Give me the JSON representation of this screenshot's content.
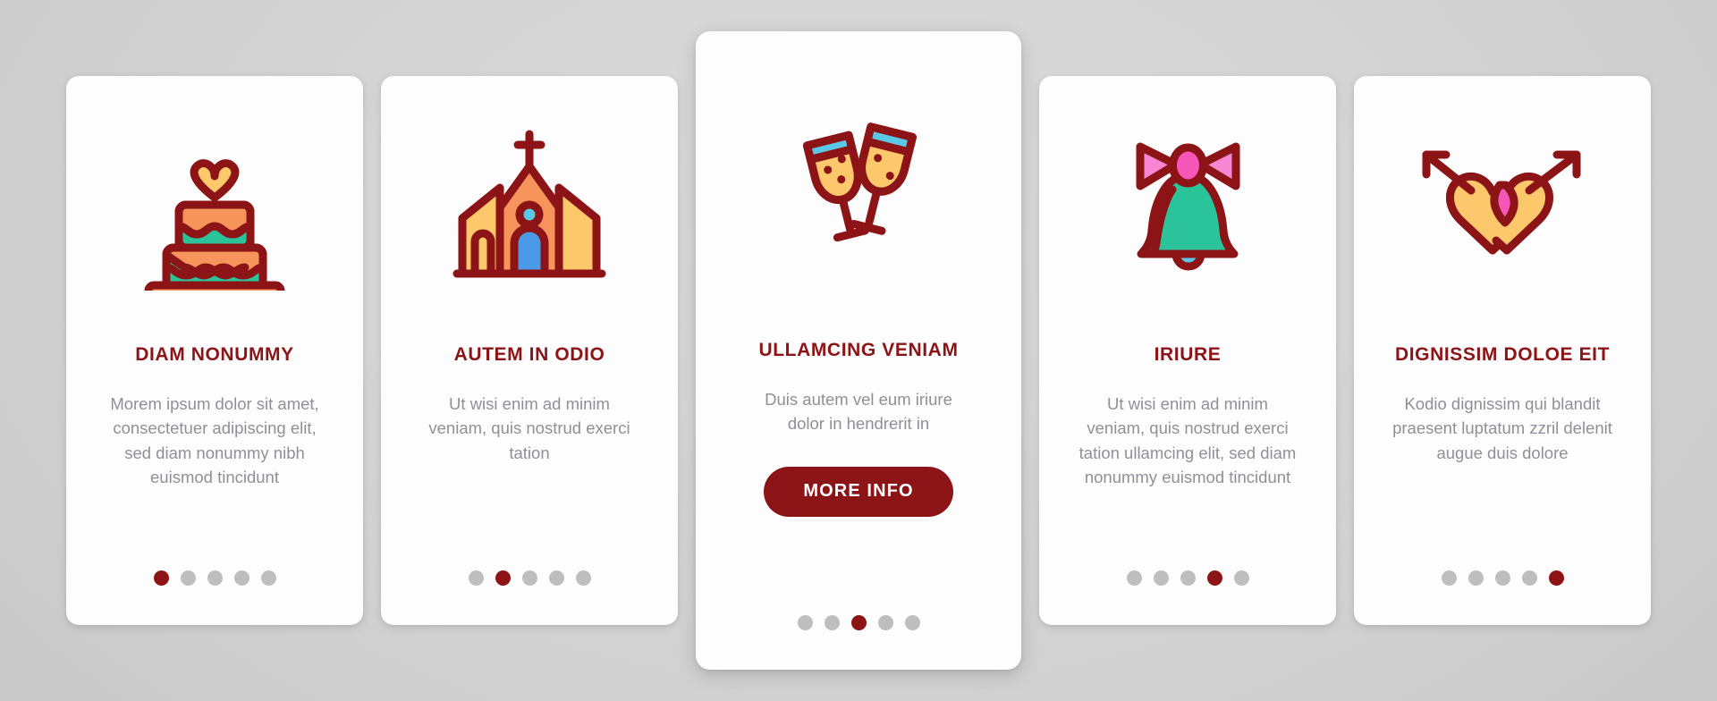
{
  "theme": {
    "accent_dark_red": "#8d1416",
    "body_text_gray": "#938d99",
    "dot_inactive_gray": "#bebebe",
    "card_bg": "#fdfdfd",
    "page_bg": "#d4d4d4",
    "icon_outline": "#8d1416",
    "icon_orange": "#f7945b",
    "icon_teal": "#2bc49a",
    "icon_yellow": "#fcc86b",
    "icon_blue": "#5cc8e8",
    "icon_pink": "#f986d2",
    "icon_magenta": "#f556b8"
  },
  "pagination": {
    "total_dots": 5
  },
  "cards": [
    {
      "icon": "wedding-cake-icon",
      "title": "DIAM NONUMMY",
      "body": "Morem ipsum dolor sit amet, consectetuer adipiscing elit, sed diam nonummy nibh euismod tincidunt",
      "active_dot": 1,
      "featured": false,
      "button_label": null
    },
    {
      "icon": "church-icon",
      "title": "AUTEM IN ODIO",
      "body": "Ut wisi enim ad minim veniam, quis nostrud exerci tation",
      "active_dot": 2,
      "featured": false,
      "button_label": null
    },
    {
      "icon": "champagne-toast-icon",
      "title": "ULLAMCING VENIAM",
      "body": "Duis autem vel eum iriure dolor in hendrerit in",
      "active_dot": 3,
      "featured": true,
      "button_label": "MORE INFO"
    },
    {
      "icon": "wedding-bell-icon",
      "title": "IRIURE",
      "body": "Ut wisi enim ad minim veniam, quis nostrud exerci tation ullamcing elit, sed diam nonummy euismod tincidunt",
      "active_dot": 4,
      "featured": false,
      "button_label": null
    },
    {
      "icon": "two-hearts-arrows-icon",
      "title": "DIGNISSIM DOLOE EIT",
      "body": "Kodio dignissim qui blandit praesent luptatum zzril delenit augue duis dolore",
      "active_dot": 5,
      "featured": false,
      "button_label": null
    }
  ]
}
